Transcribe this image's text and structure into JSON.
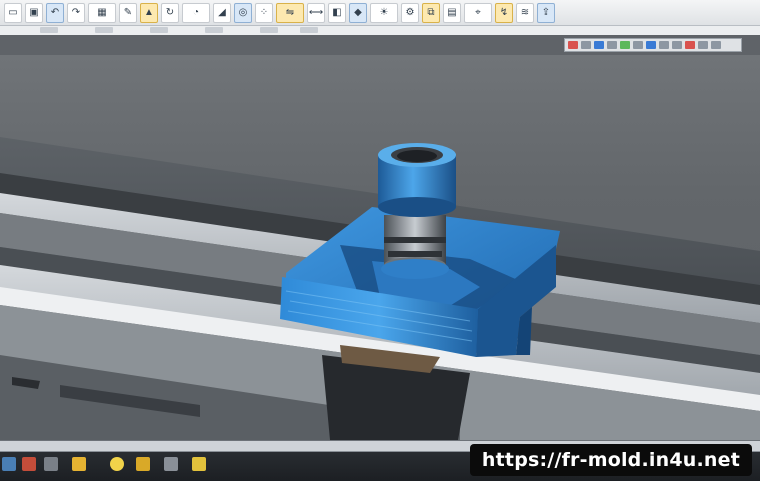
{
  "toolbar": {
    "icons": [
      "file-icon",
      "save-icon",
      "undo-icon",
      "redo-icon",
      "grid-icon",
      "sketch-icon",
      "extrude-icon",
      "revolve-icon",
      "fillet-icon",
      "chamfer-icon",
      "hole-icon",
      "pattern-icon",
      "mirror-icon",
      "measure-icon",
      "section-icon",
      "material-icon",
      "render-icon",
      "assembly-icon",
      "mate-icon",
      "drawing-icon",
      "cam-icon",
      "toolpath-icon",
      "simulate-icon",
      "export-icon"
    ]
  },
  "viewport": {
    "description_label": "",
    "colors": {
      "part_blue": "#2f7fc8",
      "part_blue_dark": "#1d5a97",
      "rail_light": "#c9ced3",
      "rail_dark": "#3e4347"
    }
  },
  "taskbar": {
    "icons": [
      "app-icon-1",
      "app-icon-2",
      "folder-icon",
      "notes-icon",
      "settings-icon",
      "files-icon",
      "lightbulb-icon"
    ]
  },
  "watermark": {
    "text": "https://fr-mold.in4u.net"
  }
}
